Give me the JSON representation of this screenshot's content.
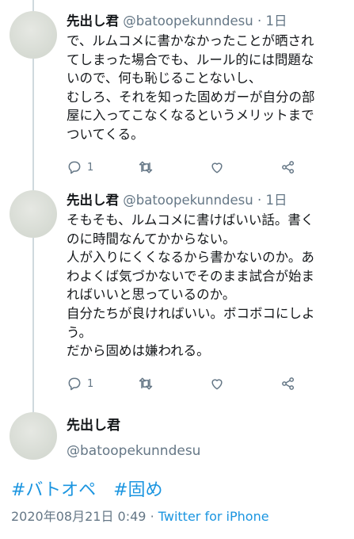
{
  "tweets": [
    {
      "name": "先出し君",
      "handle": "@batoopekunndesu",
      "dot": "·",
      "time": "1日",
      "lines": [
        "で、ルムコメに書かなかったことが晒され",
        "てしまった場合でも、ルール的には問題な",
        "いので、何も恥じることないし、",
        "むしろ、それを知った固めガーが自分の部",
        "屋に入ってこなくなるというメリットまで",
        "ついてくる。"
      ],
      "reply_count": "1",
      "icons": [
        "reply-icon",
        "retweet-icon",
        "like-icon",
        "share-icon"
      ]
    },
    {
      "name": "先出し君",
      "handle": "@batoopekunndesu",
      "dot": "·",
      "time": "1日",
      "lines": [
        "そもそも、ルムコメに書けばいい話。書く",
        "のに時間なんてかからない。",
        "人が入りにくくなるから書かないのか。あ",
        "わよくば気づかないでそのまま試合が始ま",
        "ればいいと思っているのか。",
        "自分たちが良ければいい。ボコボコにしよ",
        "う。",
        "だから固めは嫌われる。"
      ],
      "reply_count": "1",
      "icons": [
        "reply-icon",
        "retweet-icon",
        "like-icon",
        "share-icon"
      ]
    }
  ],
  "main_tweet": {
    "name": "先出し君",
    "handle": "@batoopekunndesu",
    "hashtags": [
      "#バトオペ",
      "#固め"
    ],
    "date": "2020年08月21日 0:49",
    "separator": "·",
    "source": "Twitter for iPhone"
  },
  "colors": {
    "link": "#1b95e0",
    "muted": "#657786",
    "text": "#14171a",
    "thread_line": "#cfd9de"
  }
}
